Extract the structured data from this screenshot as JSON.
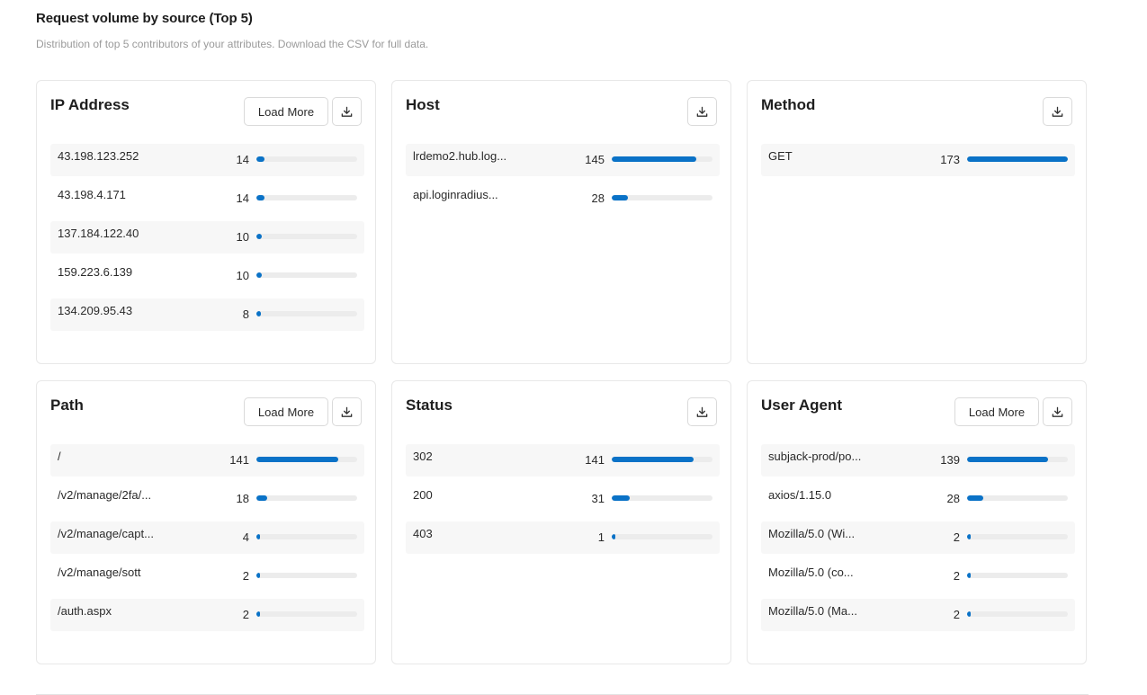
{
  "header": {
    "title": "Request volume by source (Top 5)",
    "subtitle": "Distribution of top 5 contributors of your attributes. Download the CSV for full data."
  },
  "colors": {
    "bar_fill": "#0a72c7",
    "bar_track": "#ececec",
    "row_shade": "#f7f7f7"
  },
  "icons": {
    "download": "download-icon"
  },
  "cards": [
    {
      "title": "IP Address",
      "load_more_label": "Load More",
      "max": 173,
      "rows": [
        {
          "label": "43.198.123.252",
          "count": "14",
          "value": 14
        },
        {
          "label": "43.198.4.171",
          "count": "14",
          "value": 14
        },
        {
          "label": "137.184.122.40",
          "count": "10",
          "value": 10
        },
        {
          "label": "159.223.6.139",
          "count": "10",
          "value": 10
        },
        {
          "label": "134.209.95.43",
          "count": "8",
          "value": 8
        }
      ]
    },
    {
      "title": "Host",
      "load_more_label": null,
      "max": 173,
      "rows": [
        {
          "label": "lrdemo2.hub.log...",
          "count": "145",
          "value": 145
        },
        {
          "label": "api.loginradius...",
          "count": "28",
          "value": 28
        }
      ]
    },
    {
      "title": "Method",
      "load_more_label": null,
      "max": 173,
      "rows": [
        {
          "label": "GET",
          "count": "173",
          "value": 173
        }
      ]
    },
    {
      "title": "Path",
      "load_more_label": "Load More",
      "max": 173,
      "rows": [
        {
          "label": "/",
          "count": "141",
          "value": 141
        },
        {
          "label": "/v2/manage/2fa/...",
          "count": "18",
          "value": 18
        },
        {
          "label": "/v2/manage/capt...",
          "count": "4",
          "value": 4
        },
        {
          "label": "/v2/manage/sott",
          "count": "2",
          "value": 2
        },
        {
          "label": "/auth.aspx",
          "count": "2",
          "value": 2
        }
      ]
    },
    {
      "title": "Status",
      "load_more_label": null,
      "max": 173,
      "rows": [
        {
          "label": "302",
          "count": "141",
          "value": 141
        },
        {
          "label": "200",
          "count": "31",
          "value": 31
        },
        {
          "label": "403",
          "count": "1",
          "value": 1
        }
      ]
    },
    {
      "title": "User Agent",
      "load_more_label": "Load More",
      "max": 173,
      "rows": [
        {
          "label": "subjack-prod/po...",
          "count": "139",
          "value": 139
        },
        {
          "label": "axios/1.15.0",
          "count": "28",
          "value": 28
        },
        {
          "label": "Mozilla/5.0 (Wi...",
          "count": "2",
          "value": 2
        },
        {
          "label": "Mozilla/5.0 (co...",
          "count": "2",
          "value": 2
        },
        {
          "label": "Mozilla/5.0 (Ma...",
          "count": "2",
          "value": 2
        }
      ]
    }
  ]
}
